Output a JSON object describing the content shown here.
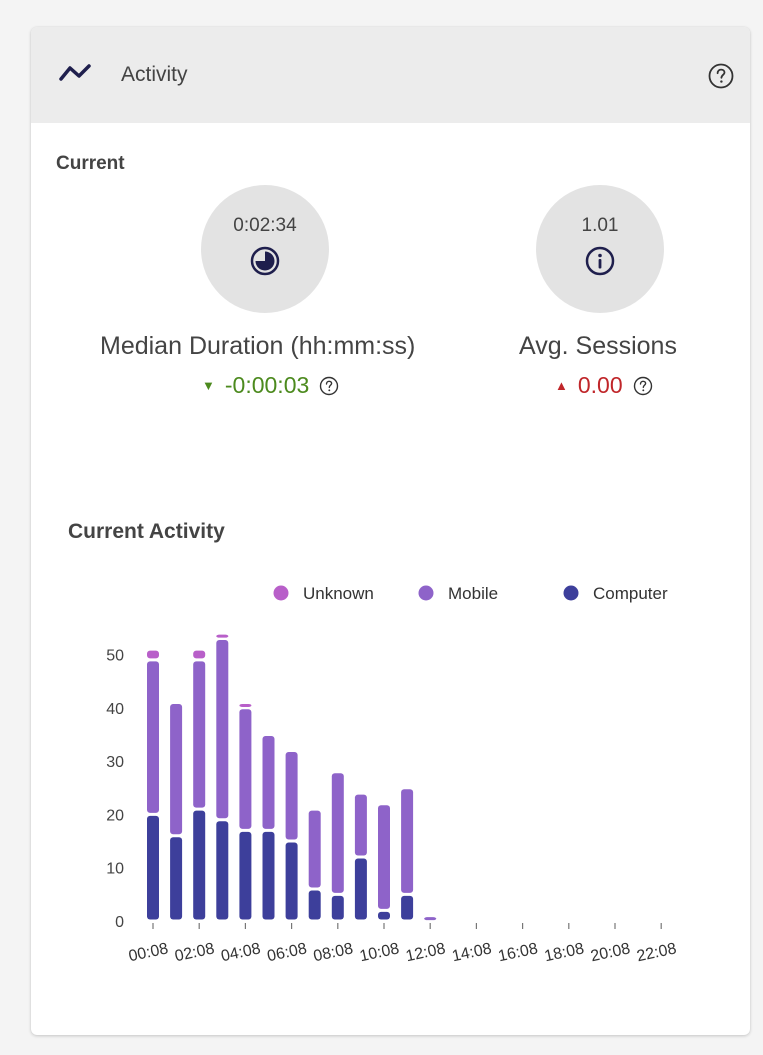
{
  "panel": {
    "title": "Activity",
    "icon": "activity-line-icon",
    "help_icon": "help-circle-icon"
  },
  "current": {
    "label": "Current",
    "metrics": [
      {
        "value": "0:02:34",
        "icon": "clock-pie-icon",
        "label": "Median Duration (hh:mm:ss)",
        "delta": "-0:00:03",
        "delta_direction": "down",
        "delta_color": "#4c8a1e"
      },
      {
        "value": "1.01",
        "icon": "info-icon",
        "label": "Avg. Sessions",
        "delta": "0.00",
        "delta_direction": "up",
        "delta_color": "#c0262a"
      }
    ]
  },
  "chart_data": {
    "type": "bar",
    "stacked": true,
    "title": "Current Activity",
    "categories": [
      "00:08",
      "01:08",
      "02:08",
      "03:08",
      "04:08",
      "05:08",
      "06:08",
      "07:08",
      "08:08",
      "09:08",
      "10:08",
      "11:08",
      "12:08",
      "13:08",
      "14:08",
      "15:08",
      "16:08",
      "17:08",
      "18:08",
      "19:08",
      "20:08",
      "21:08",
      "22:08",
      "23:08"
    ],
    "tick_labels": [
      "00:08",
      "02:08",
      "04:08",
      "06:08",
      "08:08",
      "10:08",
      "12:08",
      "14:08",
      "16:08",
      "18:08",
      "20:08",
      "22:08"
    ],
    "series": [
      {
        "name": "Computer",
        "color": "#3d3f9b",
        "values": [
          20,
          16,
          21,
          19,
          17,
          17,
          15,
          6,
          5,
          12,
          2,
          5,
          0,
          0,
          0,
          0,
          0,
          0,
          0,
          0,
          0,
          0,
          0,
          0
        ]
      },
      {
        "name": "Mobile",
        "color": "#8e63c9",
        "values": [
          29,
          25,
          28,
          34,
          23,
          18,
          17,
          15,
          23,
          12,
          20,
          20,
          1,
          0,
          0,
          0,
          0,
          0,
          0,
          0,
          0,
          0,
          0,
          0
        ]
      },
      {
        "name": "Unknown",
        "color": "#b85fc9",
        "values": [
          2,
          0,
          2,
          1,
          1,
          0,
          0,
          0,
          0,
          0,
          0,
          0,
          0,
          0,
          0,
          0,
          0,
          0,
          0,
          0,
          0,
          0,
          0,
          0
        ]
      }
    ],
    "legend_order": [
      "Unknown",
      "Mobile",
      "Computer"
    ],
    "legend_position": "top-right",
    "ylim": [
      0,
      55
    ],
    "yticks": [
      0,
      10,
      20,
      30,
      40,
      50
    ],
    "grid": false,
    "xlabel": "",
    "ylabel": ""
  }
}
